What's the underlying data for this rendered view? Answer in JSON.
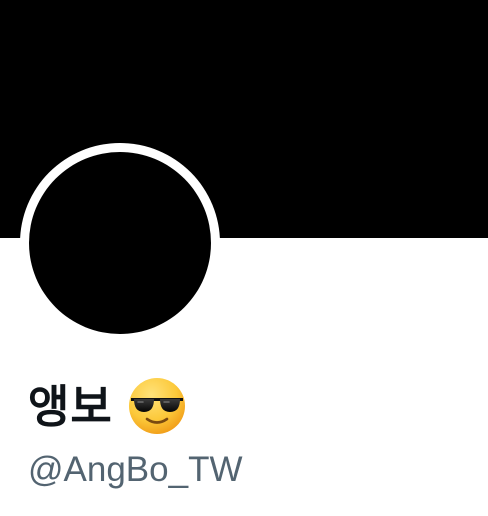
{
  "profile": {
    "display_name": "앵보",
    "name_emoji": "smiling-face-with-sunglasses-icon",
    "handle": "@AngBo_TW"
  },
  "colors": {
    "banner": "#000000",
    "avatar": "#000000",
    "avatar_ring": "#ffffff",
    "name_text": "#0f1419",
    "handle_text": "#536471"
  }
}
